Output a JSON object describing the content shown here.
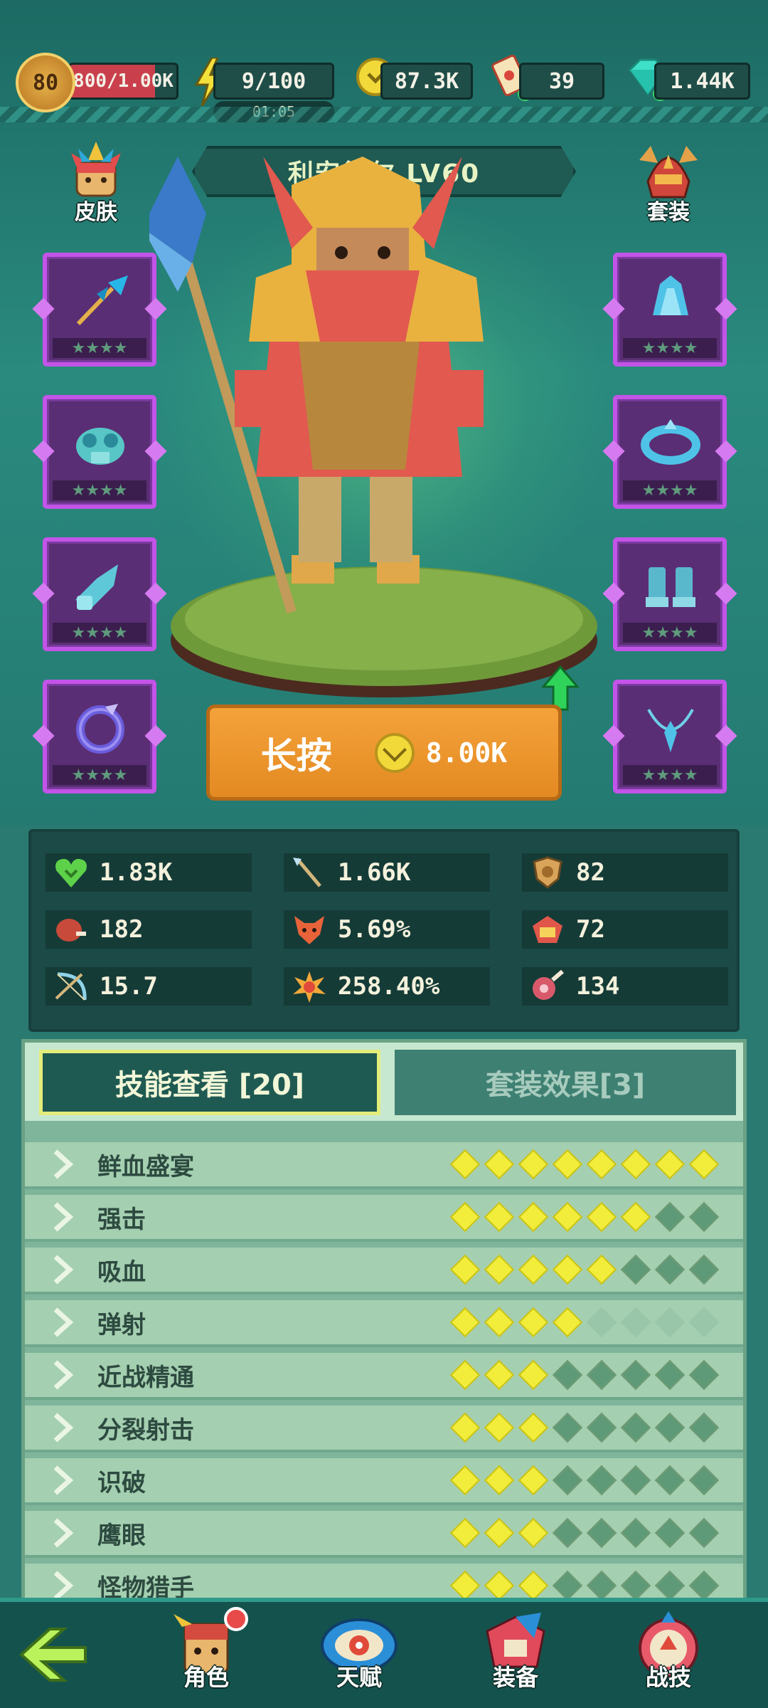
{
  "resources": {
    "level": "80",
    "xp_text": "800/1.00K",
    "xp_fraction": 0.8,
    "energy": "9/100",
    "energy_timer": "01:05",
    "coins": "87.3K",
    "tickets": "39",
    "gems": "1.44K"
  },
  "hero": {
    "name": "利安德尔 LV60",
    "skin_label": "皮肤",
    "set_label": "套装",
    "upgrade_label": "长按",
    "upgrade_cost": "8.00K"
  },
  "equipment": {
    "left": [
      {
        "icon": "spear-item-icon",
        "stars": "★★★★"
      },
      {
        "icon": "dragon-armor-icon",
        "stars": "★★★★"
      },
      {
        "icon": "glove-item-icon",
        "stars": "★★★★"
      },
      {
        "icon": "ring-item-icon",
        "stars": "★★★★"
      }
    ],
    "right": [
      {
        "icon": "crystal-helmet-icon",
        "stars": "★★★★"
      },
      {
        "icon": "crystal-belt-icon",
        "stars": "★★★★"
      },
      {
        "icon": "crystal-boots-icon",
        "stars": "★★★★"
      },
      {
        "icon": "crystal-necklace-icon",
        "stars": "★★★★"
      }
    ]
  },
  "stats": [
    {
      "icon": "heart-icon",
      "value": "1.83K"
    },
    {
      "icon": "spear-icon",
      "value": "1.66K"
    },
    {
      "icon": "shield-icon",
      "value": "82"
    },
    {
      "icon": "meat-icon",
      "value": "182"
    },
    {
      "icon": "fox-icon",
      "value": "5.69%"
    },
    {
      "icon": "cake-icon",
      "value": "72"
    },
    {
      "icon": "bow-icon",
      "value": "15.7"
    },
    {
      "icon": "burst-icon",
      "value": "258.40%"
    },
    {
      "icon": "ham-icon",
      "value": "134"
    }
  ],
  "tabs": {
    "skills": "技能查看 [20]",
    "set_effects": "套装效果[3]"
  },
  "skills": [
    {
      "name": "鲜血盛宴",
      "filled": 8,
      "blank": 0
    },
    {
      "name": "强击",
      "filled": 6,
      "blank": 0
    },
    {
      "name": "吸血",
      "filled": 5,
      "blank": 0
    },
    {
      "name": "弹射",
      "filled": 4,
      "blank": 4
    },
    {
      "name": "近战精通",
      "filled": 3,
      "blank": 0
    },
    {
      "name": "分裂射击",
      "filled": 3,
      "blank": 0
    },
    {
      "name": "识破",
      "filled": 3,
      "blank": 0
    },
    {
      "name": "鹰眼",
      "filled": 3,
      "blank": 0
    },
    {
      "name": "怪物猎手",
      "filled": 3,
      "blank": 0
    }
  ],
  "nav": {
    "hero": "角色",
    "talent": "天赋",
    "gear": "装备",
    "skill": "战技"
  },
  "colors": {
    "background": "#2a7a72",
    "slot_border": "#c354e8",
    "upgrade_orange": "#e48a22",
    "pip_on": "#f2ed3a"
  }
}
